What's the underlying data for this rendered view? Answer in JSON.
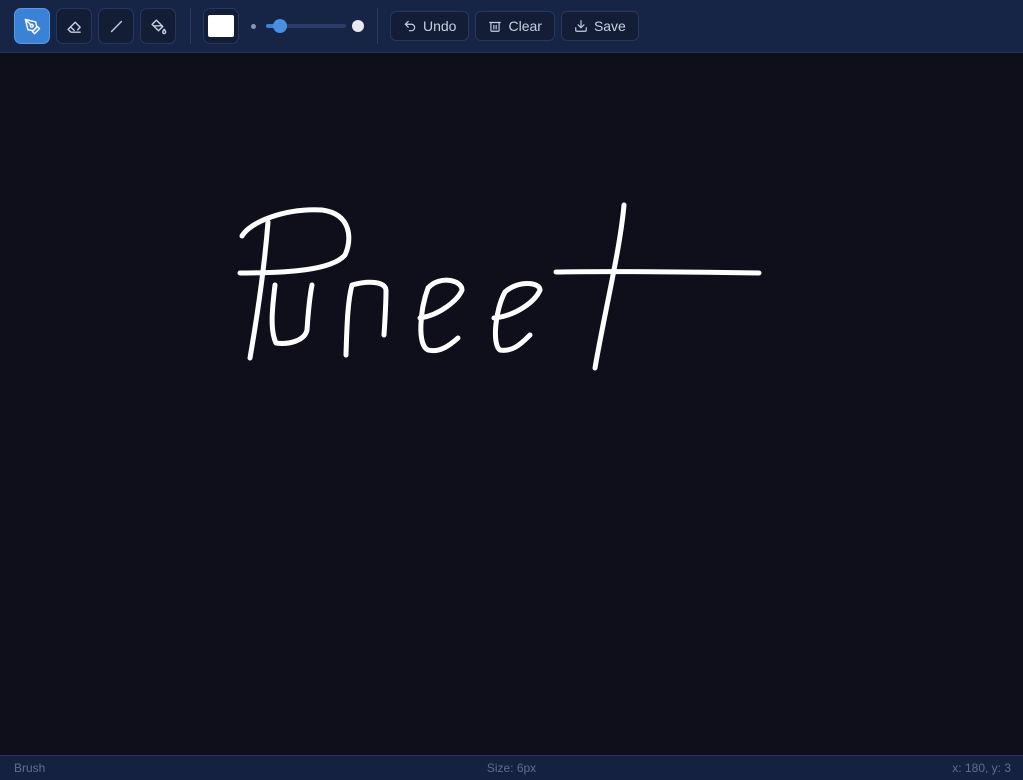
{
  "toolbar": {
    "tools": [
      {
        "name": "brush",
        "icon": "pen-icon",
        "active": true
      },
      {
        "name": "eraser",
        "icon": "eraser-icon",
        "active": false
      },
      {
        "name": "line",
        "icon": "line-icon",
        "active": false
      },
      {
        "name": "fill",
        "icon": "fill-icon",
        "active": false
      }
    ],
    "color": "#ffffff",
    "brush_size_fraction": 0.17,
    "undo_label": "Undo",
    "clear_label": "Clear",
    "save_label": "Save"
  },
  "canvas": {
    "background": "#0e0f1b",
    "stroke_color": "#ffffff",
    "drawing_text": "Puneet"
  },
  "status": {
    "tool": "Brush",
    "size": "Size: 6px",
    "coords": "x: 180, y: 3"
  },
  "colors": {
    "accent": "#3b82d6",
    "toolbar_bg": "#162445"
  }
}
